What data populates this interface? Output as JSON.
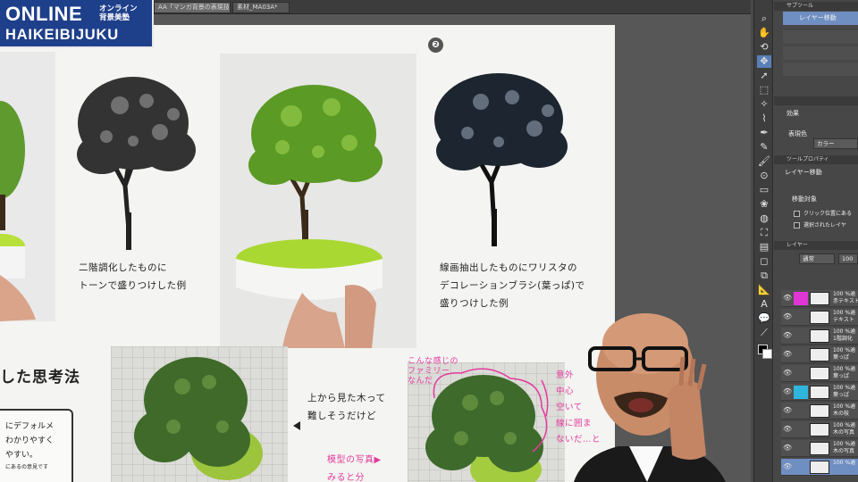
{
  "tabs": [
    {
      "label": "AA「マンガ背景の表現技法」4*",
      "active": true
    },
    {
      "label": "素材_MA03A*",
      "active": false
    }
  ],
  "logo": {
    "title": "ONLINE",
    "jp_line1": "オンライン",
    "jp_line2": "背景美塾",
    "subtitle": "HAIKEIBIJUKU",
    "color": "#1e3f8a"
  },
  "document": {
    "markers": [
      "❷"
    ],
    "caption_left": [
      "二階調化したものに",
      "トーンで盛りつけした例"
    ],
    "caption_right": [
      "線画抽出したものにワリスタの",
      "デコレーションブラシ(葉っぱ)で",
      "盛りつけした例"
    ],
    "heading": "した思考法",
    "note_lines": [
      "にデフォルメ",
      "わかりやすく",
      "やすい。",
      "にあるの意見です"
    ],
    "mid_caption": [
      "上から見た木って",
      "難しそうだけど"
    ],
    "pink_left": [
      "模型の写真▶",
      "みると分"
    ],
    "pink_annot": [
      "こんな感じの",
      "ファミリー",
      "なんだ"
    ],
    "pink_right": [
      "意外",
      "中心",
      "空いて",
      "線に囲ま",
      "ないだ…と"
    ]
  },
  "panel": {
    "subtool_header": "サブツール",
    "subtool_selected": "レイヤー移動",
    "effects_header": "効果",
    "expression_label": "表現色",
    "expression_value": "カラー",
    "tool_property_header": "ツールプロパティ",
    "tool_name": "レイヤー移動",
    "move_target_label": "移動対象",
    "option1": "クリック位置にある",
    "option2": "選択されたレイヤ",
    "layer_header": "レイヤー",
    "blend_mode": "通常",
    "opacity": "100"
  },
  "layers": [
    {
      "name": "100 %通\n赤テキスト",
      "tag": "magenta",
      "selected": false
    },
    {
      "name": "100 %通\nテキスト",
      "tag": "none",
      "selected": false
    },
    {
      "name": "100 %通\n1階調化",
      "tag": "none",
      "selected": false
    },
    {
      "name": "100 %通\n葉っぱ",
      "tag": "none",
      "selected": false
    },
    {
      "name": "100 %通\n葉っぱ",
      "tag": "none",
      "selected": false
    },
    {
      "name": "100 %通\n葉っぱ",
      "tag": "cyan",
      "selected": false
    },
    {
      "name": "100 %通\n木の枝",
      "tag": "none",
      "selected": false
    },
    {
      "name": "100 %通\n木の写真",
      "tag": "none",
      "selected": false
    },
    {
      "name": "100 %通\n木の写真",
      "tag": "none",
      "selected": false
    },
    {
      "name": "100 %通\n",
      "tag": "none",
      "selected": true
    }
  ]
}
